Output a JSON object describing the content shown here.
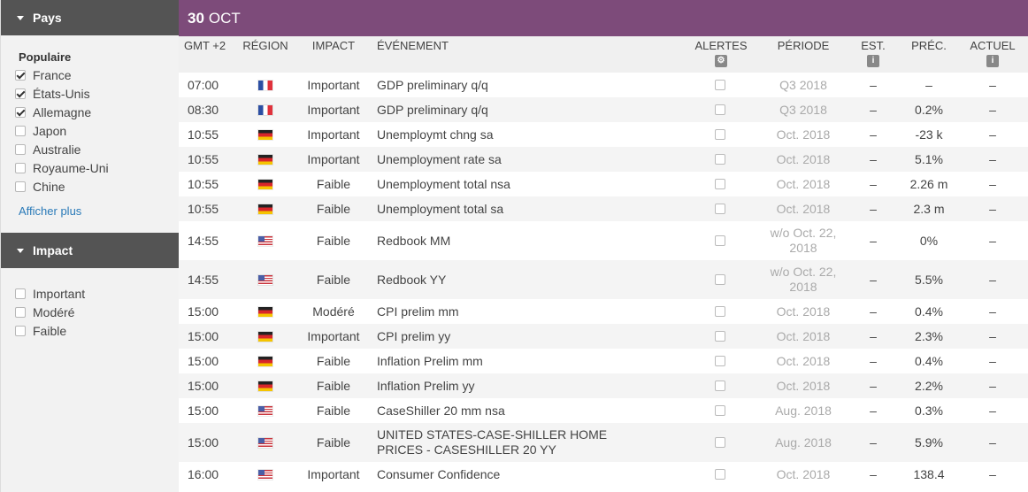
{
  "sidebar": {
    "country_header": "Pays",
    "popular_label": "Populaire",
    "countries": [
      {
        "label": "France",
        "checked": true
      },
      {
        "label": "États-Unis",
        "checked": true
      },
      {
        "label": "Allemagne",
        "checked": true
      },
      {
        "label": "Japon",
        "checked": false
      },
      {
        "label": "Australie",
        "checked": false
      },
      {
        "label": "Royaume-Uni",
        "checked": false
      },
      {
        "label": "Chine",
        "checked": false
      }
    ],
    "show_more": "Afficher plus",
    "impact_header": "Impact",
    "impacts": [
      {
        "label": "Important",
        "checked": false
      },
      {
        "label": "Modéré",
        "checked": false
      },
      {
        "label": "Faible",
        "checked": false
      }
    ]
  },
  "main": {
    "date_day": "30",
    "date_month": "OCT",
    "headers": {
      "time": "GMT +2",
      "region": "RÉGION",
      "impact": "IMPACT",
      "event": "ÉVÉNEMENT",
      "alerts": "ALERTES",
      "period": "PÉRIODE",
      "est": "EST.",
      "prev": "PRÉC.",
      "actual": "ACTUEL"
    },
    "rows": [
      {
        "time": "07:00",
        "flag": "fr",
        "impact": "Important",
        "event": "GDP preliminary q/q",
        "period": "Q3 2018",
        "est": "–",
        "prev": "–",
        "actual": "–"
      },
      {
        "time": "08:30",
        "flag": "fr",
        "impact": "Important",
        "event": "GDP preliminary q/q",
        "period": "Q3 2018",
        "est": "–",
        "prev": "0.2%",
        "actual": "–"
      },
      {
        "time": "10:55",
        "flag": "de",
        "impact": "Important",
        "event": "Unemploymt chng sa",
        "period": "Oct. 2018",
        "est": "–",
        "prev": "-23 k",
        "actual": "–"
      },
      {
        "time": "10:55",
        "flag": "de",
        "impact": "Important",
        "event": "Unemployment rate sa",
        "period": "Oct. 2018",
        "est": "–",
        "prev": "5.1%",
        "actual": "–"
      },
      {
        "time": "10:55",
        "flag": "de",
        "impact": "Faible",
        "event": "Unemployment total nsa",
        "period": "Oct. 2018",
        "est": "–",
        "prev": "2.26 m",
        "actual": "–"
      },
      {
        "time": "10:55",
        "flag": "de",
        "impact": "Faible",
        "event": "Unemployment total sa",
        "period": "Oct. 2018",
        "est": "–",
        "prev": "2.3 m",
        "actual": "–"
      },
      {
        "time": "14:55",
        "flag": "us",
        "impact": "Faible",
        "event": "Redbook MM",
        "period": "w/o Oct. 22, 2018",
        "est": "–",
        "prev": "0%",
        "actual": "–"
      },
      {
        "time": "14:55",
        "flag": "us",
        "impact": "Faible",
        "event": "Redbook YY",
        "period": "w/o Oct. 22, 2018",
        "est": "–",
        "prev": "5.5%",
        "actual": "–"
      },
      {
        "time": "15:00",
        "flag": "de",
        "impact": "Modéré",
        "event": "CPI prelim mm",
        "period": "Oct. 2018",
        "est": "–",
        "prev": "0.4%",
        "actual": "–"
      },
      {
        "time": "15:00",
        "flag": "de",
        "impact": "Important",
        "event": "CPI prelim yy",
        "period": "Oct. 2018",
        "est": "–",
        "prev": "2.3%",
        "actual": "–"
      },
      {
        "time": "15:00",
        "flag": "de",
        "impact": "Faible",
        "event": "Inflation Prelim mm",
        "period": "Oct. 2018",
        "est": "–",
        "prev": "0.4%",
        "actual": "–"
      },
      {
        "time": "15:00",
        "flag": "de",
        "impact": "Faible",
        "event": "Inflation Prelim yy",
        "period": "Oct. 2018",
        "est": "–",
        "prev": "2.2%",
        "actual": "–"
      },
      {
        "time": "15:00",
        "flag": "us",
        "impact": "Faible",
        "event": "CaseShiller 20 mm nsa",
        "period": "Aug. 2018",
        "est": "–",
        "prev": "0.3%",
        "actual": "–"
      },
      {
        "time": "15:00",
        "flag": "us",
        "impact": "Faible",
        "event": "UNITED STATES-CASE-SHILLER HOME PRICES - CASESHILLER 20 YY",
        "period": "Aug. 2018",
        "est": "–",
        "prev": "5.9%",
        "actual": "–"
      },
      {
        "time": "16:00",
        "flag": "us",
        "impact": "Important",
        "event": "Consumer Confidence",
        "period": "Oct. 2018",
        "est": "–",
        "prev": "138.4",
        "actual": "–"
      }
    ]
  }
}
